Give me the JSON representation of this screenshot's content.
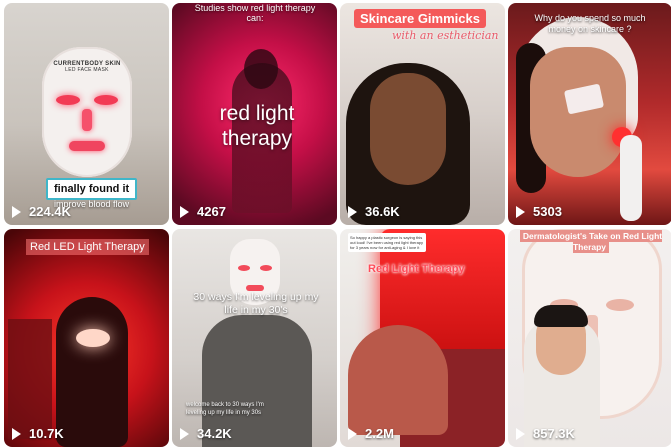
{
  "videos": [
    {
      "views": "224.4K",
      "overlay_label": "finally found it",
      "overlay_sub": "improve blood flow",
      "mask_brand": "CURRENTBODY SKIN",
      "mask_sub": "LED FACE MASK"
    },
    {
      "views": "4267",
      "overlay_top": "Studies show red light therapy can:",
      "overlay_big": "red light therapy"
    },
    {
      "views": "36.6K",
      "overlay_title": "Skincare Gimmicks",
      "overlay_script": "with an esthetician"
    },
    {
      "views": "5303",
      "overlay_caption": "Why do you spend so much money on skincare ?"
    },
    {
      "views": "10.7K",
      "overlay_title": "Red LED Light Therapy"
    },
    {
      "views": "34.2K",
      "overlay_big": "30 ways I'm leveling up my life in my 30's",
      "overlay_small": "welcome back to 30 ways I'm leveling up my life in my 30s"
    },
    {
      "views": "2.2M",
      "overlay_note": "So happy a plastic surgeon is saying this out loud! I've been using red light therapy for 3 years now for anti-aging & I love it",
      "overlay_title": "Red Light Therapy"
    },
    {
      "views": "857.3K",
      "overlay_caption": "Dermatologist's Take on Red Light Therapy"
    }
  ]
}
